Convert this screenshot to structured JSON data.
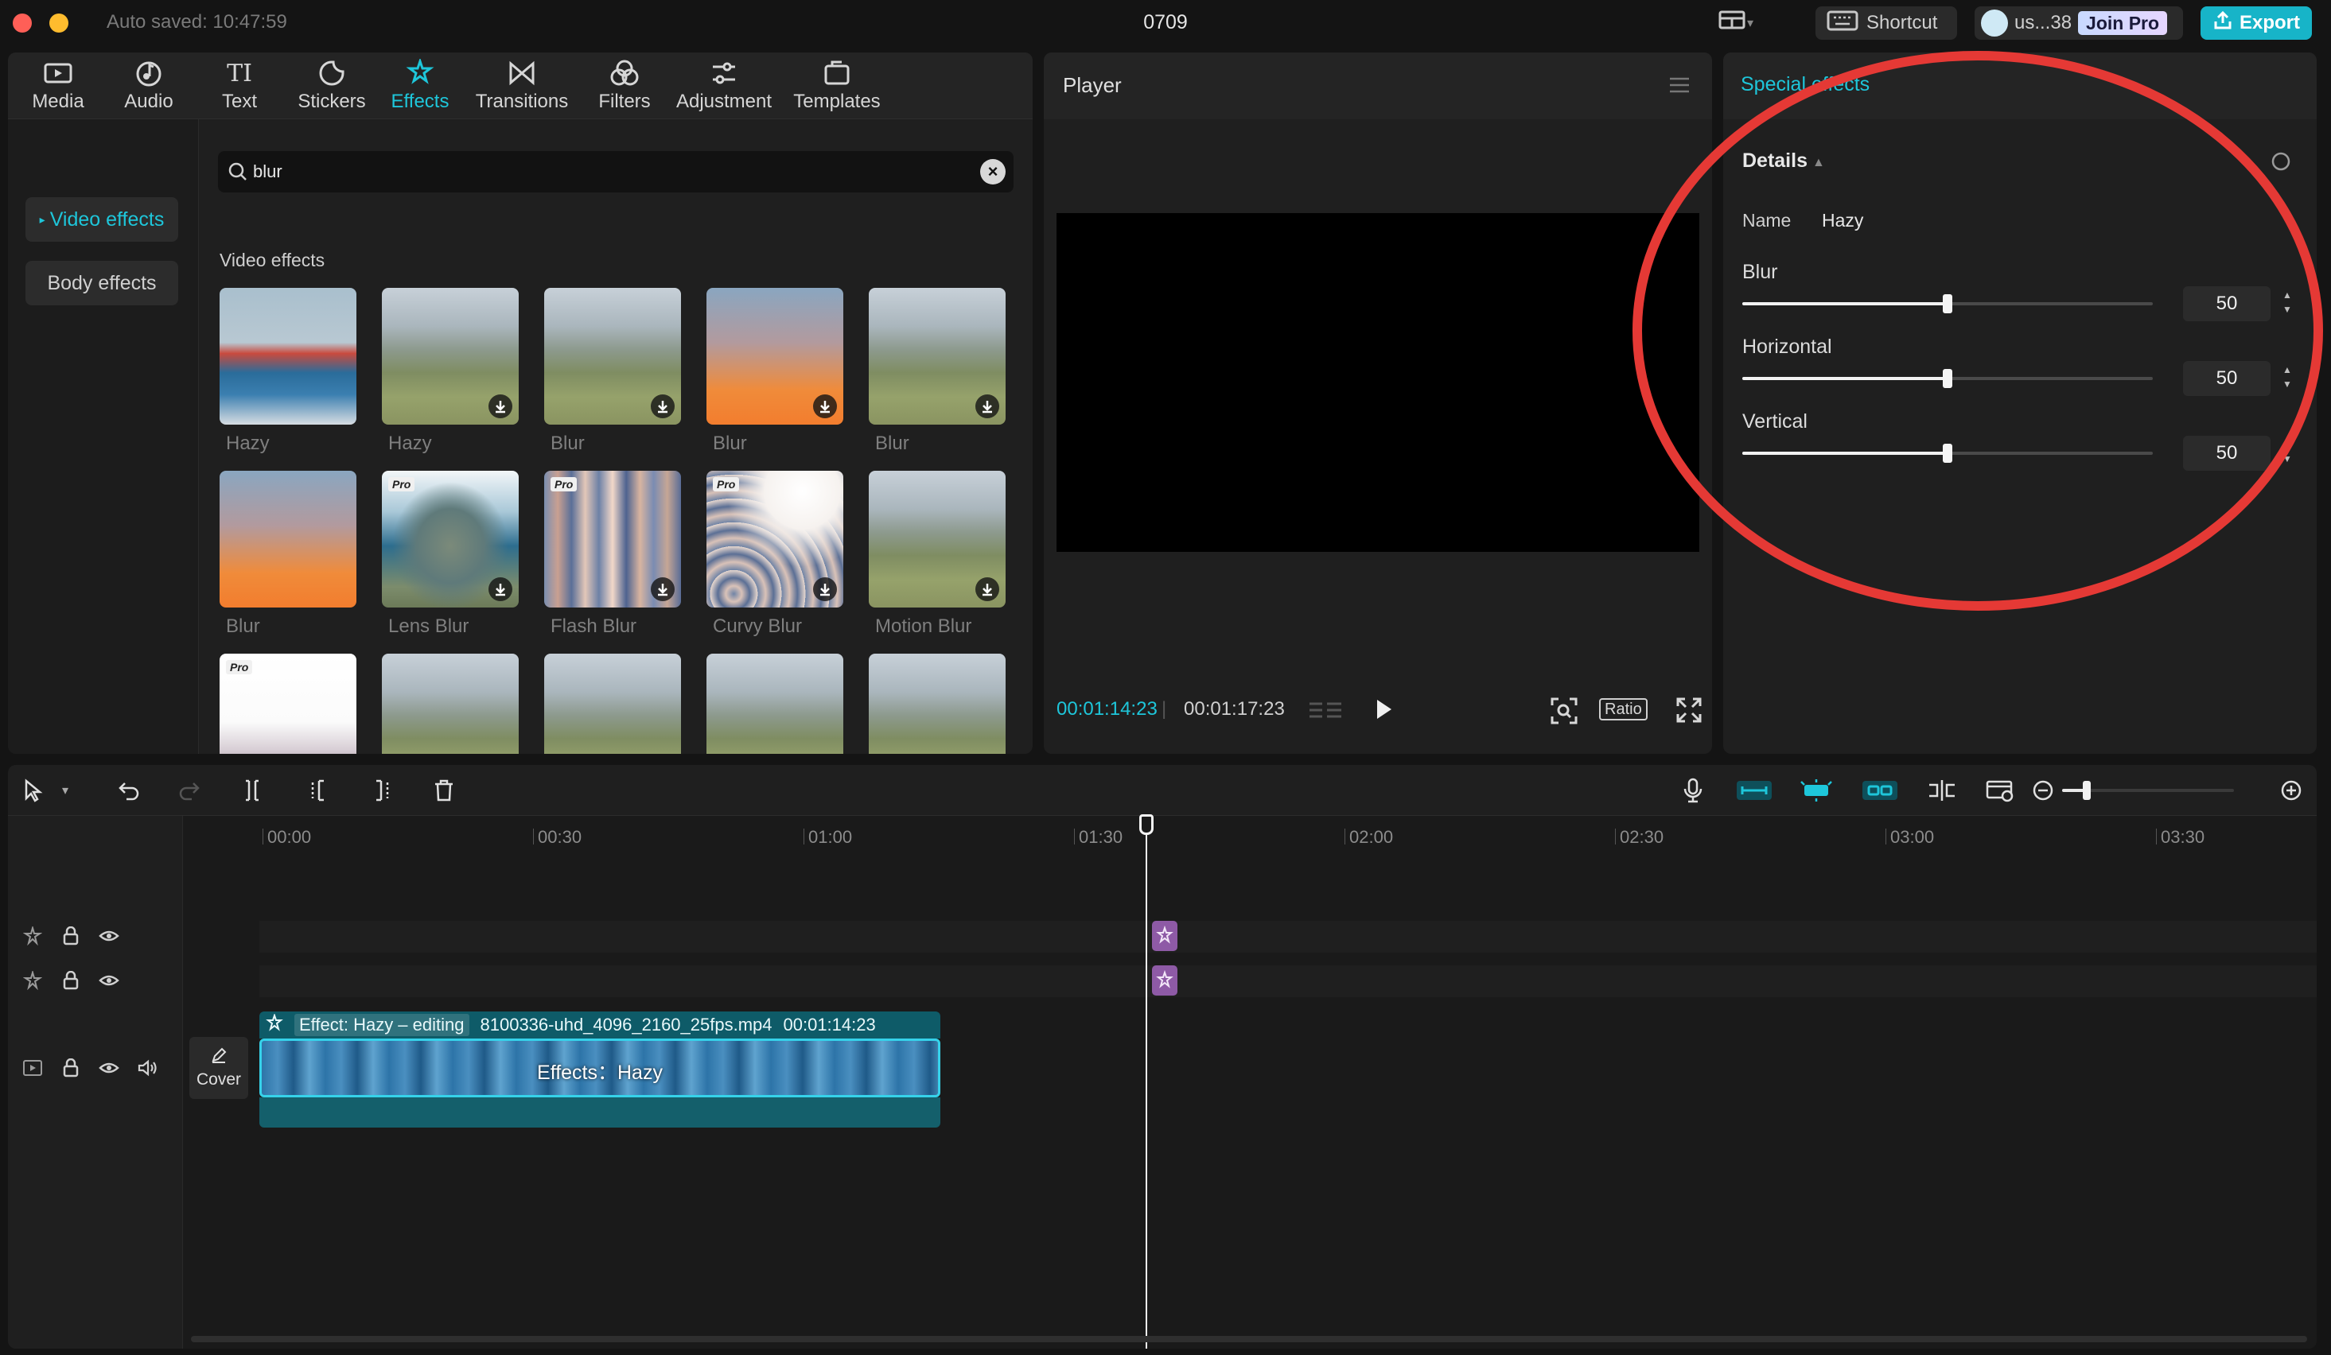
{
  "window": {
    "autosaved": "Auto saved: 10:47:59",
    "project_name": "0709",
    "shortcut_label": "Shortcut",
    "user_label": "us...38",
    "join_pro_label": "Join Pro",
    "export_label": "Export"
  },
  "tool_tabs": [
    {
      "label": "Media",
      "icon": "media-icon"
    },
    {
      "label": "Audio",
      "icon": "audio-icon"
    },
    {
      "label": "Text",
      "icon": "text-icon"
    },
    {
      "label": "Stickers",
      "icon": "stickers-icon"
    },
    {
      "label": "Effects",
      "icon": "effects-icon",
      "active": true
    },
    {
      "label": "Transitions",
      "icon": "transitions-icon"
    },
    {
      "label": "Filters",
      "icon": "filters-icon"
    },
    {
      "label": "Adjustment",
      "icon": "adjustment-icon"
    },
    {
      "label": "Templates",
      "icon": "templates-icon"
    }
  ],
  "categories": {
    "video_effects": "Video effects",
    "body_effects": "Body effects"
  },
  "search": {
    "value": "blur",
    "placeholder": "Search"
  },
  "grid": {
    "title": "Video effects",
    "items": [
      {
        "label": "Hazy",
        "pro": false,
        "download": false
      },
      {
        "label": "Hazy",
        "pro": false,
        "download": true
      },
      {
        "label": "Blur",
        "pro": false,
        "download": true
      },
      {
        "label": "Blur",
        "pro": false,
        "download": true
      },
      {
        "label": "Blur",
        "pro": false,
        "download": true
      },
      {
        "label": "Blur",
        "pro": false,
        "download": false
      },
      {
        "label": "Lens Blur",
        "pro": true,
        "download": true
      },
      {
        "label": "Flash Blur",
        "pro": true,
        "download": true
      },
      {
        "label": "Curvy Blur",
        "pro": true,
        "download": true
      },
      {
        "label": "Motion Blur",
        "pro": false,
        "download": true
      },
      {
        "label": "",
        "pro": true,
        "download": false
      },
      {
        "label": "",
        "pro": false,
        "download": false
      },
      {
        "label": "",
        "pro": false,
        "download": false
      },
      {
        "label": "",
        "pro": false,
        "download": false
      },
      {
        "label": "",
        "pro": false,
        "download": false
      }
    ],
    "pro_badge": "Pro"
  },
  "player": {
    "title": "Player",
    "current_time": "00:01:14:23",
    "separator": "|",
    "total_time": "00:01:17:23",
    "ratio_label": "Ratio"
  },
  "special_effects": {
    "title": "Special effects",
    "details_label": "Details",
    "name_key": "Name",
    "name_value": "Hazy",
    "params": [
      {
        "label": "Blur",
        "value": "50",
        "level": 0.5
      },
      {
        "label": "Horizontal",
        "value": "50",
        "level": 0.5
      },
      {
        "label": "Vertical",
        "value": "50",
        "level": 0.5
      }
    ]
  },
  "timeline": {
    "ruler": [
      "00:00",
      "00:30",
      "01:00",
      "01:30",
      "02:00",
      "02:30",
      "03:00",
      "03:30"
    ],
    "clip": {
      "effect_tag": "Effect: Hazy – editing",
      "filename": "8100336-uhd_4096_2160_25fps.mp4",
      "duration": "00:01:14:23",
      "center_label": "Effects：Hazy"
    },
    "cover_label": "Cover"
  },
  "colors": {
    "accent": "#1ec6da",
    "annotation": "#e53935",
    "effect_marker": "#8e5aa6",
    "clip_border": "#36d2ea"
  }
}
